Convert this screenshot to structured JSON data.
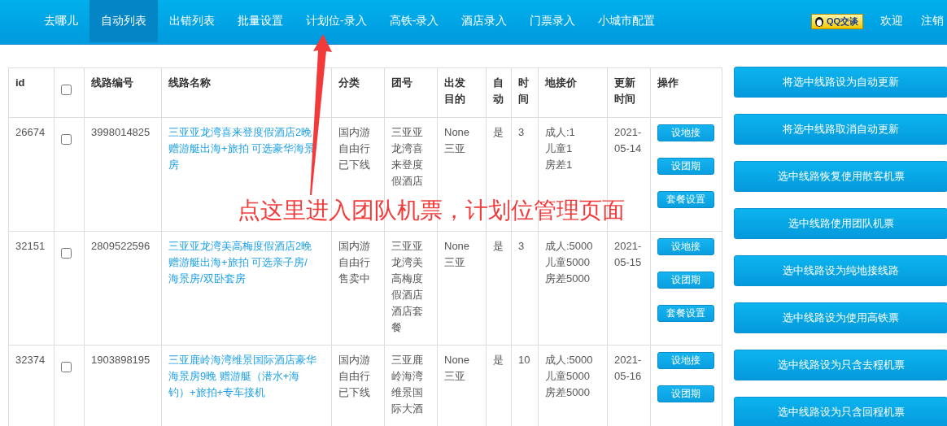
{
  "nav": {
    "items": [
      {
        "label": "去哪儿",
        "selected": false
      },
      {
        "label": "自动列表",
        "selected": true
      },
      {
        "label": "出错列表",
        "selected": false
      },
      {
        "label": "批量设置",
        "selected": false
      },
      {
        "label": "计划位-录入",
        "selected": false
      },
      {
        "label": "高铁-录入",
        "selected": false
      },
      {
        "label": "酒店录入",
        "selected": false
      },
      {
        "label": "门票录入",
        "selected": false
      },
      {
        "label": "小城市配置",
        "selected": false
      }
    ],
    "qq_button": "QQ交谈",
    "welcome": "欢迎",
    "logout": "注销"
  },
  "table": {
    "columns": [
      "id",
      "",
      "线路编号",
      "线路名称",
      "分类",
      "团号",
      "出发目的",
      "自动",
      "时间",
      "地接价",
      "更新时间",
      "操作"
    ],
    "select_all_checked": false,
    "rows": [
      {
        "id": "26674",
        "checked": false,
        "code": "3998014825",
        "name": "三亚亚龙湾喜来登度假酒店2晚赠游艇出海+旅拍 可选豪华海景房",
        "category": "国内游自由行已下线",
        "group": "三亚亚龙湾喜来登度假酒店",
        "destination": "None 三亚",
        "auto": "是",
        "days": "3",
        "price": [
          "成人:1",
          "儿童1",
          "房差1"
        ],
        "updated": "2021-05-14",
        "actions": [
          "设地接",
          "设团期",
          "套餐设置"
        ]
      },
      {
        "id": "32151",
        "checked": false,
        "code": "2809522596",
        "name": "三亚亚龙湾美高梅度假酒店2晚赠游艇出海+旅拍 可选亲子房/海景房/双卧套房",
        "category": "国内游自由行售卖中",
        "group": "三亚亚龙湾美高梅度假酒店酒店套餐",
        "destination": "None 三亚",
        "auto": "是",
        "days": "3",
        "price": [
          "成人:5000",
          "儿童5000",
          "房差5000"
        ],
        "updated": "2021-05-15",
        "actions": [
          "设地接",
          "设团期",
          "套餐设置"
        ]
      },
      {
        "id": "32374",
        "checked": false,
        "code": "1903898195",
        "name": "三亚鹿岭海湾维景国际酒店豪华海景房9晚 赠游艇（潜水+海钓）+旅拍+专车接机",
        "category": "国内游自由行已下线",
        "group": "三亚鹿岭海湾维景国际大酒",
        "destination": "None 三亚",
        "auto": "是",
        "days": "10",
        "price": [
          "成人:5000",
          "儿童5000",
          "房差5000"
        ],
        "updated": "2021-05-16",
        "actions": [
          "设地接",
          "设团期"
        ]
      }
    ]
  },
  "side_buttons": [
    "将选中线路设为自动更新",
    "将选中线路取消自动更新",
    "选中线路恢复使用散客机票",
    "选中线路使用团队机票",
    "选中线路设为纯地接线路",
    "选中线路设为使用高铁票",
    "选中线路设为只含去程机票",
    "选中线路设为只含回程机票"
  ],
  "annotation": {
    "text": "点这里进入团队机票，计划位管理页面"
  }
}
